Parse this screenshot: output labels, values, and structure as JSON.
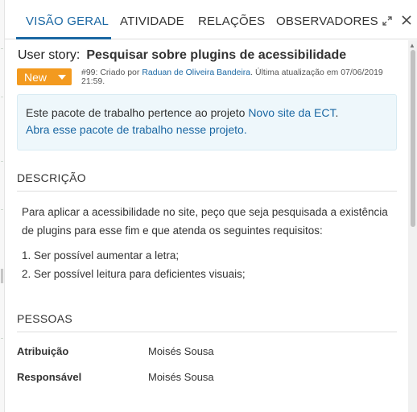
{
  "tabs": [
    {
      "label": "VISÃO GERAL",
      "active": true
    },
    {
      "label": "ATIVIDADE",
      "active": false
    },
    {
      "label": "RELAÇÕES",
      "active": false
    },
    {
      "label": "OBSERVADORES",
      "active": false
    }
  ],
  "header_icons": {
    "expand": "expand-icon",
    "close": "close-icon"
  },
  "work_package": {
    "type": "User story:",
    "subject": "Pesquisar sobre plugins de acessibilidade",
    "status": "New",
    "meta": {
      "prefix": "#99: Criado por",
      "author": "Raduan de Oliveira Bandeira",
      "suffix": ". Última atualização em 07/06/2019 21:59."
    }
  },
  "notice": {
    "line1_prefix": "Este pacote de trabalho pertence ao projeto",
    "project_link": "Novo site da ECT",
    "line1_suffix": ".",
    "line2_link": "Abra esse pacote de trabalho nesse projeto."
  },
  "description": {
    "title": "DESCRIÇÃO",
    "paragraph": "Para aplicar a acessibilidade no site, peço que seja pesquisada a existência de plugins para esse fim e que atenda os seguintes requisitos:",
    "items": [
      "1. Ser possível aumentar a letra;",
      "2. Ser possível leitura para deficientes visuais;"
    ]
  },
  "people": {
    "title": "PESSOAS",
    "fields": [
      {
        "label": "Atribuição",
        "value": "Moisés Sousa"
      },
      {
        "label": "Responsável",
        "value": "Moisés Sousa"
      }
    ]
  },
  "colors": {
    "accent": "#1a67a3",
    "status": "#f39a1f",
    "notice_bg": "#eef7fb"
  }
}
